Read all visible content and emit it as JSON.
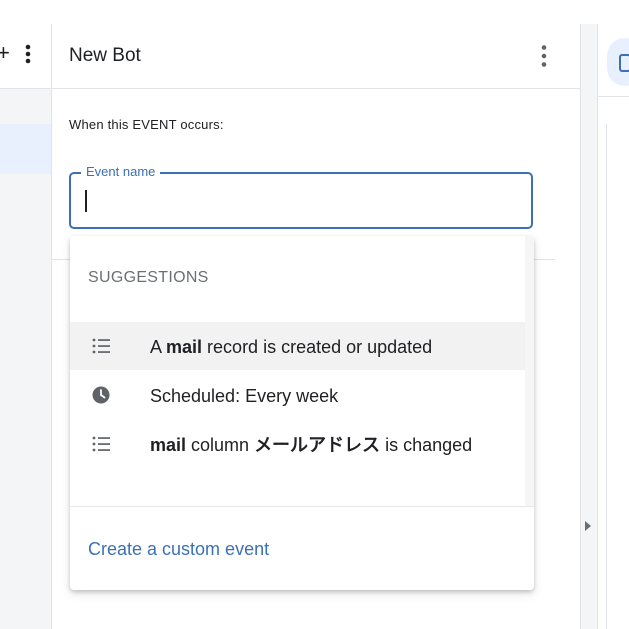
{
  "header": {
    "title": "New Bot"
  },
  "event_section": {
    "label": "When this EVENT occurs:",
    "input": {
      "label": "Event name",
      "value": ""
    }
  },
  "suggestions": {
    "heading": "SUGGESTIONS",
    "items": [
      {
        "icon": "list-icon",
        "prefix": "A ",
        "bold": "mail",
        "suffix": " record is created or updated"
      },
      {
        "icon": "clock-icon",
        "prefix": "Scheduled: Every week",
        "bold": "",
        "suffix": ""
      },
      {
        "icon": "list-icon",
        "prefix": "",
        "bold": "mail",
        "suffix_plain": " column ",
        "bold2": "メールアドレス",
        "suffix": " is changed"
      }
    ],
    "create_link": "Create a custom event"
  },
  "left_panel": {
    "add_label": "+"
  },
  "colors": {
    "accent": "#3c70b5",
    "selected_bg": "#e8f0fe",
    "hover_bg": "#f2f2f3"
  }
}
